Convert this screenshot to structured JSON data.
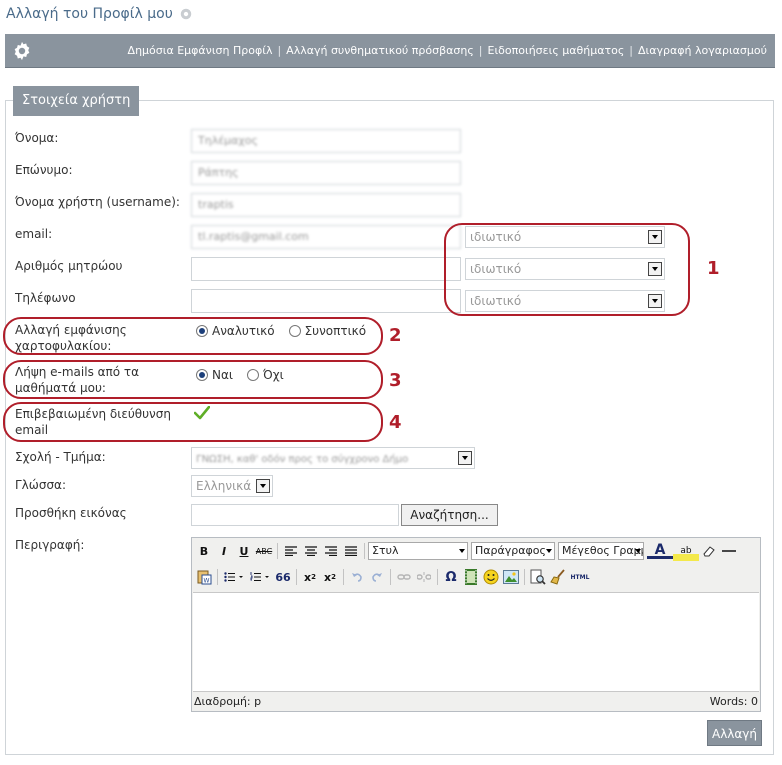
{
  "page": {
    "title": "Αλλαγή του Προφίλ μου"
  },
  "toolbar": {
    "links": [
      "Δημόσια Εμφάνιση Προφίλ",
      "Αλλαγή συνθηματικού πρόσβασης",
      "Ειδοποιήσεις μαθήματος",
      "Διαγραφή λογαριασμού"
    ]
  },
  "section": {
    "legend": "Στοιχεία χρήστη"
  },
  "form": {
    "name_label": "Όνομα:",
    "name_value": "Τηλέμαχος",
    "surname_label": "Επώνυμο:",
    "surname_value": "Ράπτης",
    "username_label": "Όνομα χρήστη (username):",
    "username_value": "traptis",
    "email_label": "email:",
    "email_value": "tl.raptis@gmail.com",
    "email_privacy": "ιδιωτικό",
    "am_label": "Αριθμός μητρώου",
    "am_value": "",
    "am_privacy": "ιδιωτικό",
    "phone_label": "Τηλέφωνο",
    "phone_value": "",
    "phone_privacy": "ιδιωτικό",
    "portfolio_label": "Αλλαγή εμφάνισης χαρτοφυλακίου:",
    "portfolio_options": [
      "Αναλυτικό",
      "Συνοπτικό"
    ],
    "emails_label": "Λήψη e-mails από τα μαθήματά μου:",
    "emails_options": [
      "Ναι",
      "Όχι"
    ],
    "verified_label": "Επιβεβαιωμένη διεύθυνση email",
    "faculty_label": "Σχολή - Τμήμα:",
    "faculty_value": "ΓΝΩΣΗ, καθ' οδόν προς το σύγχρονο Δήμο",
    "language_label": "Γλώσσα:",
    "language_value": "Ελληνικά",
    "image_label": "Προσθήκη εικόνας",
    "browse_label": "Αναζήτηση...",
    "description_label": "Περιγραφή:",
    "submit_label": "Αλλαγή"
  },
  "editor": {
    "style_select": "Στυλ",
    "format_select": "Παράγραφος",
    "size_select": "Μέγεθος Γραμμ",
    "path_text": "Διαδρομή: p",
    "words_text": "Words: 0",
    "bold": "B",
    "italic": "I",
    "underline": "U",
    "strike": "ABC",
    "quote": "66",
    "subscript_base": "x",
    "subscript_mark": "2",
    "superscript_base": "x",
    "superscript_mark": "2",
    "omega": "Ω",
    "html": "HTML",
    "textcolor": "A",
    "highlight": "ab"
  },
  "annotations": [
    "1",
    "2",
    "3",
    "4"
  ],
  "colors": {
    "toolbar": "#8a949e",
    "annotation": "#b01e2a",
    "link": "#4a6b8a"
  }
}
